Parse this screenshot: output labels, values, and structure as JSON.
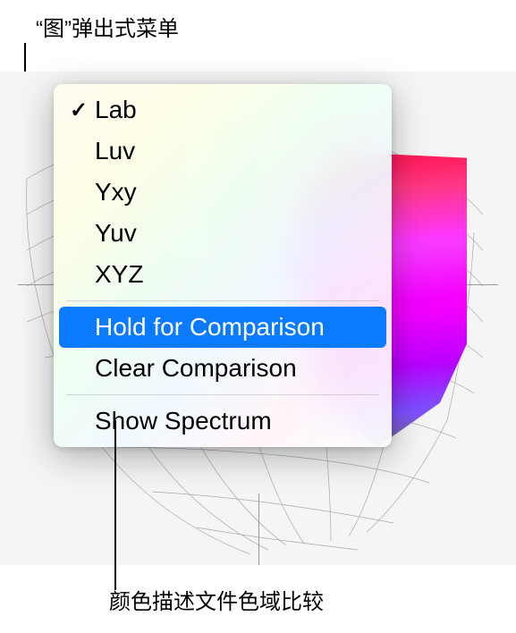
{
  "callouts": {
    "top": "“图”弹出式菜单",
    "bottom": "颜色描述文件色域比较"
  },
  "menu": {
    "items": [
      {
        "label": "Lab",
        "checked": true
      },
      {
        "label": "Luv",
        "checked": false
      },
      {
        "label": "Yxy",
        "checked": false
      },
      {
        "label": "Yuv",
        "checked": false
      },
      {
        "label": "XYZ",
        "checked": false
      }
    ],
    "compare": {
      "hold": "Hold for Comparison",
      "clear": "Clear Comparison"
    },
    "spectrum": "Show Spectrum",
    "checkmark": "✓"
  }
}
